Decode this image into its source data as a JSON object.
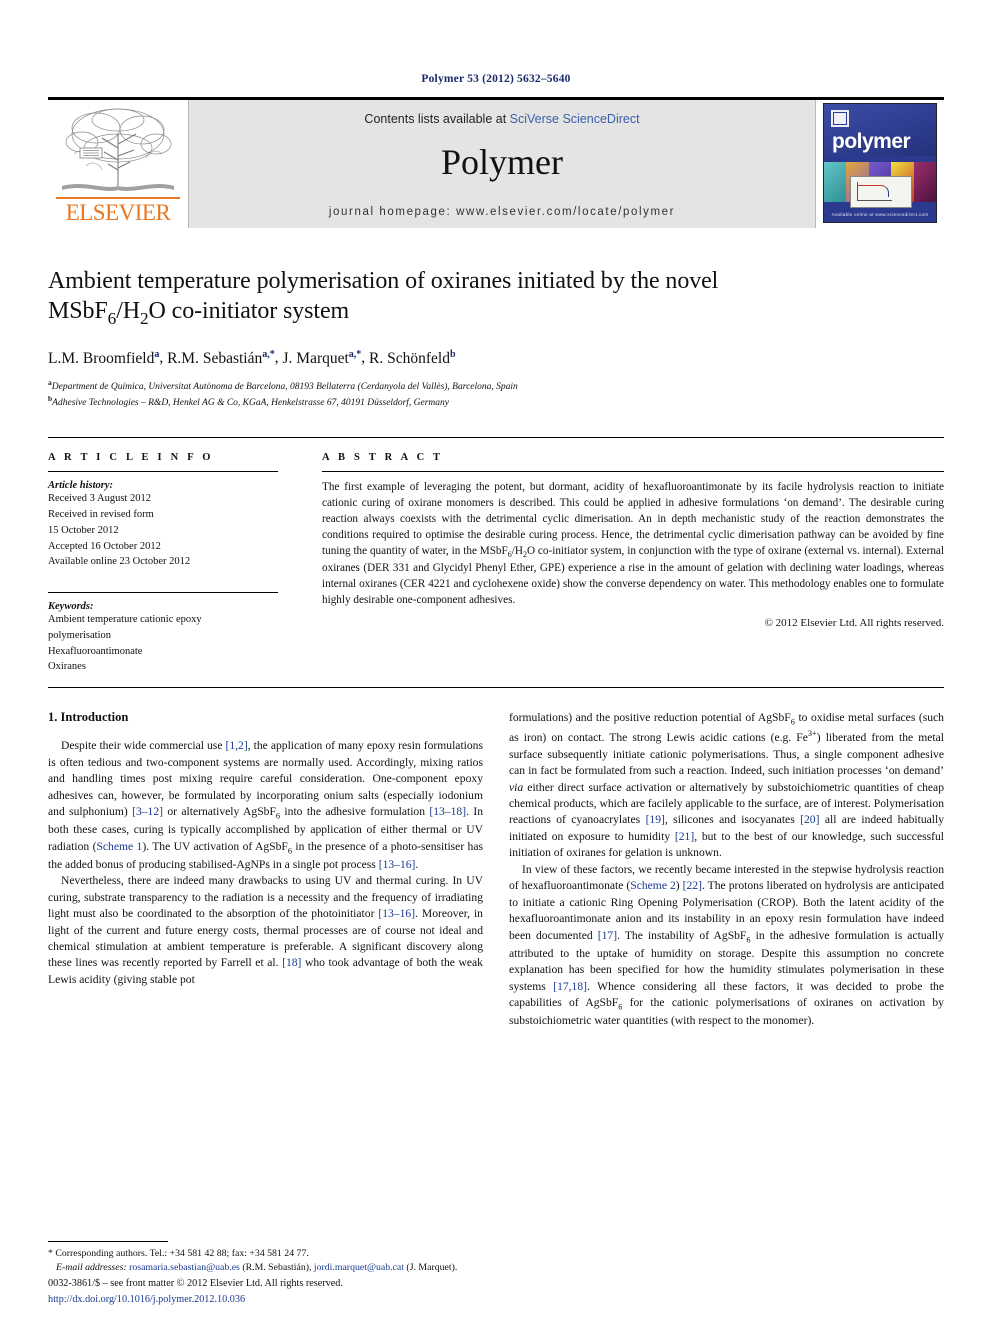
{
  "running_head": "Polymer 53 (2012) 5632–5640",
  "masthead": {
    "publisher_name": "ELSEVIER",
    "contents_prefix": "Contents lists available at ",
    "contents_link": "SciVerse ScienceDirect",
    "journal_name": "Polymer",
    "homepage": "journal homepage: www.elsevier.com/locate/polymer",
    "cover_title": "polymer",
    "cover_footer": "Available online at www.sciencedirect.com"
  },
  "article": {
    "title_line1": "Ambient temperature polymerisation of oxiranes initiated by the novel",
    "title_line2_pre": "MSbF",
    "title_line2_sub1": "6",
    "title_line2_mid": "/H",
    "title_line2_sub2": "2",
    "title_line2_post": "O co-initiator system",
    "authors": [
      {
        "name": "L.M. Broomfield",
        "marks": "a"
      },
      {
        "name": "R.M. Sebastián",
        "marks": "a,*"
      },
      {
        "name": "J. Marquet",
        "marks": "a,*"
      },
      {
        "name": "R. Schönfeld",
        "marks": "b"
      }
    ],
    "affiliations": [
      {
        "mark": "a",
        "text": "Department de Química, Universitat Autònoma de Barcelona, 08193 Bellaterra (Cerdanyola del Vallès), Barcelona, Spain"
      },
      {
        "mark": "b",
        "text": "Adhesive Technologies – R&D, Henkel AG & Co, KGaA, Henkelstrasse 67, 40191 Düsseldorf, Germany"
      }
    ]
  },
  "article_info": {
    "heading": "A R T I C L E  I N F O",
    "history_label": "Article history:",
    "history": [
      "Received 3 August 2012",
      "Received in revised form",
      "15 October 2012",
      "Accepted 16 October 2012",
      "Available online 23 October 2012"
    ],
    "keywords_label": "Keywords:",
    "keywords": [
      "Ambient temperature cationic epoxy",
      "polymerisation",
      "Hexafluoroantimonate",
      "Oxiranes"
    ]
  },
  "abstract": {
    "heading": "A B S T R A C T",
    "p1": "The first example of leveraging the potent, but dormant, acidity of hexafluoroantimonate by its facile hydrolysis reaction to initiate cationic curing of oxirane monomers is described. This could be applied in adhesive formulations ‘on demand’. The desirable curing reaction always coexists with the detrimental cyclic dimerisation. An in depth mechanistic study of the reaction demonstrates the conditions required to optimise the desirable curing process. Hence, the detrimental cyclic dimerisation pathway can be avoided by fine tuning the quantity of water, in the MSbF",
    "p1_sub1": "6",
    "p1_b": "/H",
    "p1_sub2": "2",
    "p1_c": "O co-initiator system, in conjunction with the type of oxirane (external vs. internal). External oxiranes (DER 331 and Glycidyl Phenyl Ether, GPE) experience a rise in the amount of gelation with declining water loadings, whereas internal oxiranes (CER 4221 and cyclohexene oxide) show the converse dependency on water. This methodology enables one to formulate highly desirable one-component adhesives.",
    "rights": "© 2012 Elsevier Ltd. All rights reserved."
  },
  "body": {
    "section_number_title": "1. Introduction",
    "left": {
      "p1_a": "Despite their wide commercial use ",
      "p1_ref1": "[1,2]",
      "p1_b": ", the application of many epoxy resin formulations is often tedious and two-component systems are normally used. Accordingly, mixing ratios and handling times post mixing require careful consideration. One-component epoxy adhesives can, however, be formulated by incorporating onium salts (especially iodonium and sulphonium) ",
      "p1_ref2": "[3–12]",
      "p1_c": " or alternatively AgSbF",
      "p1_sub": "6",
      "p1_d": " into the adhesive formulation ",
      "p1_ref3": "[13–18]",
      "p1_e": ". In both these cases, curing is typically accomplished by application of either thermal or UV radiation (",
      "p1_scheme": "Scheme 1",
      "p1_f": "). The UV activation of AgSbF",
      "p1_sub2": "6",
      "p1_g": " in the presence of a photo-sensitiser has the added bonus of producing stabilised-AgNPs in a single pot process ",
      "p1_ref4": "[13–16]",
      "p1_h": ".",
      "p2_a": "Nevertheless, there are indeed many drawbacks to using UV and thermal curing. In UV curing, substrate transparency to the radiation is a necessity and the frequency of irradiating light must also be coordinated to the absorption of the photoinitiator ",
      "p2_ref1": "[13–16]",
      "p2_b": ". Moreover, in light of the current and future energy costs, thermal processes are of course not ideal and chemical stimulation at ambient temperature is preferable. A significant discovery along these lines was recently reported by Farrell et al. ",
      "p2_ref2": "[18]",
      "p2_c": " who took advantage of both the weak Lewis acidity (giving stable pot"
    },
    "right": {
      "p1_a": "formulations) and the positive reduction potential of AgSbF",
      "p1_sub": "6",
      "p1_b": " to oxidise metal surfaces (such as iron) on contact. The strong Lewis acidic cations (e.g. Fe",
      "p1_sup": "3+",
      "p1_c": ") liberated from the metal surface subsequently initiate cationic polymerisations. Thus, a single component adhesive can in fact be formulated from such a reaction. Indeed, such initiation processes ‘on demand’ ",
      "p1_via": "via",
      "p1_d": " either direct surface activation or alternatively by substoichiometric quantities of cheap chemical products, which are facilely applicable to the surface, are of interest. Polymerisation reactions of cyanoacrylates ",
      "p1_ref1": "[19]",
      "p1_e": ", silicones and isocyanates ",
      "p1_ref2": "[20]",
      "p1_f": " all are indeed habitually initiated on exposure to humidity ",
      "p1_ref3": "[21]",
      "p1_g": ", but to the best of our knowledge, such successful initiation of oxiranes for gelation is unknown.",
      "p2_a": "In view of these factors, we recently became interested in the stepwise hydrolysis reaction of hexafluoroantimonate (",
      "p2_scheme": "Scheme 2",
      "p2_b": ") ",
      "p2_ref1": "[22]",
      "p2_c": ". The protons liberated on hydrolysis are anticipated to initiate a cationic Ring Opening Polymerisation (CROP). Both the latent acidity of the hexafluoroantimonate anion and its instability in an epoxy resin formulation have indeed been documented ",
      "p2_ref2": "[17]",
      "p2_d": ". The instability of AgSbF",
      "p2_sub": "6",
      "p2_e": " in the adhesive formulation is actually attributed to the uptake of humidity on storage. Despite this assumption no concrete explanation has been specified for how the humidity stimulates polymerisation in these systems ",
      "p2_ref3": "[17,18]",
      "p2_f": ". Whence considering all these factors, it was decided to probe the capabilities of AgSbF",
      "p2_sub2": "6",
      "p2_g": " for the cationic polymerisations of oxiranes on activation by substoichiometric water quantities (with respect to the monomer)."
    }
  },
  "footnotes": {
    "corresponding": "* Corresponding authors. Tel.: +34 581 42 88; fax: +34 581 24 77.",
    "email_label": "E-mail addresses:",
    "email1": "rosamaria.sebastian@uab.es",
    "email1_name": " (R.M. Sebastián), ",
    "email2": "jordi.marquet@uab.cat",
    "email2_name": " (J. Marquet)."
  },
  "copyright": {
    "line1": "0032-3861/$ – see front matter © 2012 Elsevier Ltd. All rights reserved.",
    "doi": "http://dx.doi.org/10.1016/j.polymer.2012.10.036"
  },
  "colors": {
    "link_blue": "#1a3a8f",
    "elsevier_orange": "#E87722",
    "cover_blue": "#2b3a8f"
  }
}
